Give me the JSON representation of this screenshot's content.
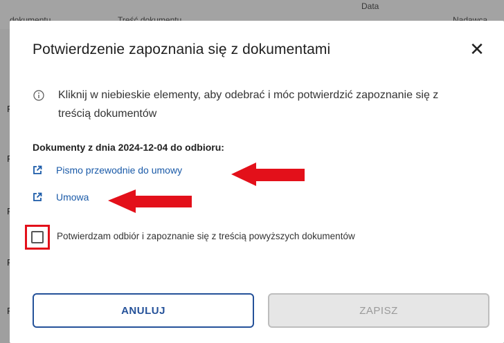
{
  "background": {
    "headers": [
      "dokumentu",
      "Treść dokumentu",
      "Data",
      "Nadawca"
    ],
    "row_marks": [
      "P",
      "P",
      "P",
      "P",
      "P"
    ]
  },
  "modal": {
    "title": "Potwierdzenie zapoznania się z dokumentami",
    "close_icon": "close-icon",
    "info_text": "Kliknij w niebieskie elementy, aby odebrać i móc potwierdzić zapoznanie się z treścią dokumentów",
    "docs_heading": "Dokumenty z dnia 2024-12-04 do odbioru:",
    "documents": [
      {
        "label": "Pismo przewodnie do umowy",
        "icon": "external-link-icon"
      },
      {
        "label": "Umowa",
        "icon": "external-link-icon"
      }
    ],
    "confirm_label": "Potwierdzam odbiór i zapoznanie się z treścią powyższych dokumentów",
    "confirm_checked": false,
    "cancel_label": "ANULUJ",
    "save_label": "ZAPISZ",
    "save_disabled": true
  },
  "colors": {
    "accent": "#245199",
    "link": "#1a5aa8",
    "annotation_red": "#e3101a",
    "disabled_bg": "#e6e6e6"
  }
}
